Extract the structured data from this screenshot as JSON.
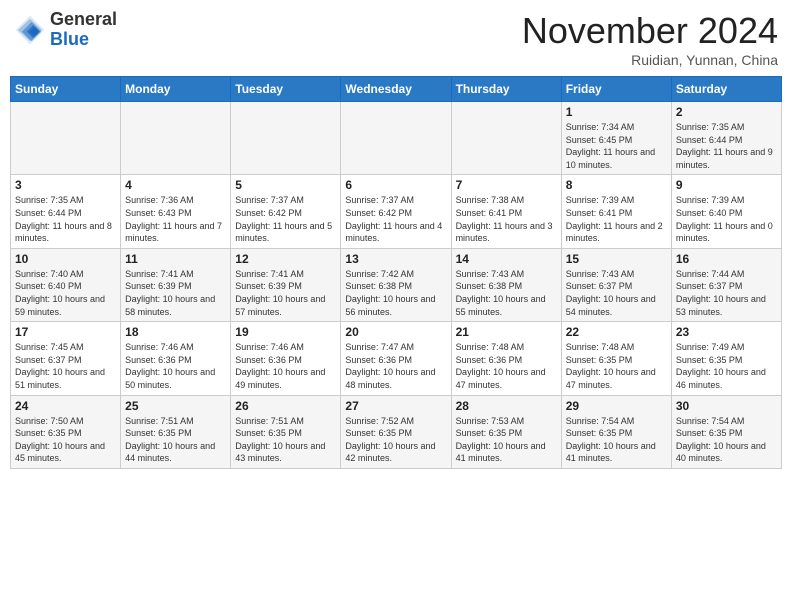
{
  "header": {
    "logo_general": "General",
    "logo_blue": "Blue",
    "month": "November 2024",
    "location": "Ruidian, Yunnan, China"
  },
  "days_of_week": [
    "Sunday",
    "Monday",
    "Tuesday",
    "Wednesday",
    "Thursday",
    "Friday",
    "Saturday"
  ],
  "weeks": [
    [
      {
        "day": "",
        "info": ""
      },
      {
        "day": "",
        "info": ""
      },
      {
        "day": "",
        "info": ""
      },
      {
        "day": "",
        "info": ""
      },
      {
        "day": "",
        "info": ""
      },
      {
        "day": "1",
        "info": "Sunrise: 7:34 AM\nSunset: 6:45 PM\nDaylight: 11 hours and 10 minutes."
      },
      {
        "day": "2",
        "info": "Sunrise: 7:35 AM\nSunset: 6:44 PM\nDaylight: 11 hours and 9 minutes."
      }
    ],
    [
      {
        "day": "3",
        "info": "Sunrise: 7:35 AM\nSunset: 6:44 PM\nDaylight: 11 hours and 8 minutes."
      },
      {
        "day": "4",
        "info": "Sunrise: 7:36 AM\nSunset: 6:43 PM\nDaylight: 11 hours and 7 minutes."
      },
      {
        "day": "5",
        "info": "Sunrise: 7:37 AM\nSunset: 6:42 PM\nDaylight: 11 hours and 5 minutes."
      },
      {
        "day": "6",
        "info": "Sunrise: 7:37 AM\nSunset: 6:42 PM\nDaylight: 11 hours and 4 minutes."
      },
      {
        "day": "7",
        "info": "Sunrise: 7:38 AM\nSunset: 6:41 PM\nDaylight: 11 hours and 3 minutes."
      },
      {
        "day": "8",
        "info": "Sunrise: 7:39 AM\nSunset: 6:41 PM\nDaylight: 11 hours and 2 minutes."
      },
      {
        "day": "9",
        "info": "Sunrise: 7:39 AM\nSunset: 6:40 PM\nDaylight: 11 hours and 0 minutes."
      }
    ],
    [
      {
        "day": "10",
        "info": "Sunrise: 7:40 AM\nSunset: 6:40 PM\nDaylight: 10 hours and 59 minutes."
      },
      {
        "day": "11",
        "info": "Sunrise: 7:41 AM\nSunset: 6:39 PM\nDaylight: 10 hours and 58 minutes."
      },
      {
        "day": "12",
        "info": "Sunrise: 7:41 AM\nSunset: 6:39 PM\nDaylight: 10 hours and 57 minutes."
      },
      {
        "day": "13",
        "info": "Sunrise: 7:42 AM\nSunset: 6:38 PM\nDaylight: 10 hours and 56 minutes."
      },
      {
        "day": "14",
        "info": "Sunrise: 7:43 AM\nSunset: 6:38 PM\nDaylight: 10 hours and 55 minutes."
      },
      {
        "day": "15",
        "info": "Sunrise: 7:43 AM\nSunset: 6:37 PM\nDaylight: 10 hours and 54 minutes."
      },
      {
        "day": "16",
        "info": "Sunrise: 7:44 AM\nSunset: 6:37 PM\nDaylight: 10 hours and 53 minutes."
      }
    ],
    [
      {
        "day": "17",
        "info": "Sunrise: 7:45 AM\nSunset: 6:37 PM\nDaylight: 10 hours and 51 minutes."
      },
      {
        "day": "18",
        "info": "Sunrise: 7:46 AM\nSunset: 6:36 PM\nDaylight: 10 hours and 50 minutes."
      },
      {
        "day": "19",
        "info": "Sunrise: 7:46 AM\nSunset: 6:36 PM\nDaylight: 10 hours and 49 minutes."
      },
      {
        "day": "20",
        "info": "Sunrise: 7:47 AM\nSunset: 6:36 PM\nDaylight: 10 hours and 48 minutes."
      },
      {
        "day": "21",
        "info": "Sunrise: 7:48 AM\nSunset: 6:36 PM\nDaylight: 10 hours and 47 minutes."
      },
      {
        "day": "22",
        "info": "Sunrise: 7:48 AM\nSunset: 6:35 PM\nDaylight: 10 hours and 47 minutes."
      },
      {
        "day": "23",
        "info": "Sunrise: 7:49 AM\nSunset: 6:35 PM\nDaylight: 10 hours and 46 minutes."
      }
    ],
    [
      {
        "day": "24",
        "info": "Sunrise: 7:50 AM\nSunset: 6:35 PM\nDaylight: 10 hours and 45 minutes."
      },
      {
        "day": "25",
        "info": "Sunrise: 7:51 AM\nSunset: 6:35 PM\nDaylight: 10 hours and 44 minutes."
      },
      {
        "day": "26",
        "info": "Sunrise: 7:51 AM\nSunset: 6:35 PM\nDaylight: 10 hours and 43 minutes."
      },
      {
        "day": "27",
        "info": "Sunrise: 7:52 AM\nSunset: 6:35 PM\nDaylight: 10 hours and 42 minutes."
      },
      {
        "day": "28",
        "info": "Sunrise: 7:53 AM\nSunset: 6:35 PM\nDaylight: 10 hours and 41 minutes."
      },
      {
        "day": "29",
        "info": "Sunrise: 7:54 AM\nSunset: 6:35 PM\nDaylight: 10 hours and 41 minutes."
      },
      {
        "day": "30",
        "info": "Sunrise: 7:54 AM\nSunset: 6:35 PM\nDaylight: 10 hours and 40 minutes."
      }
    ]
  ]
}
